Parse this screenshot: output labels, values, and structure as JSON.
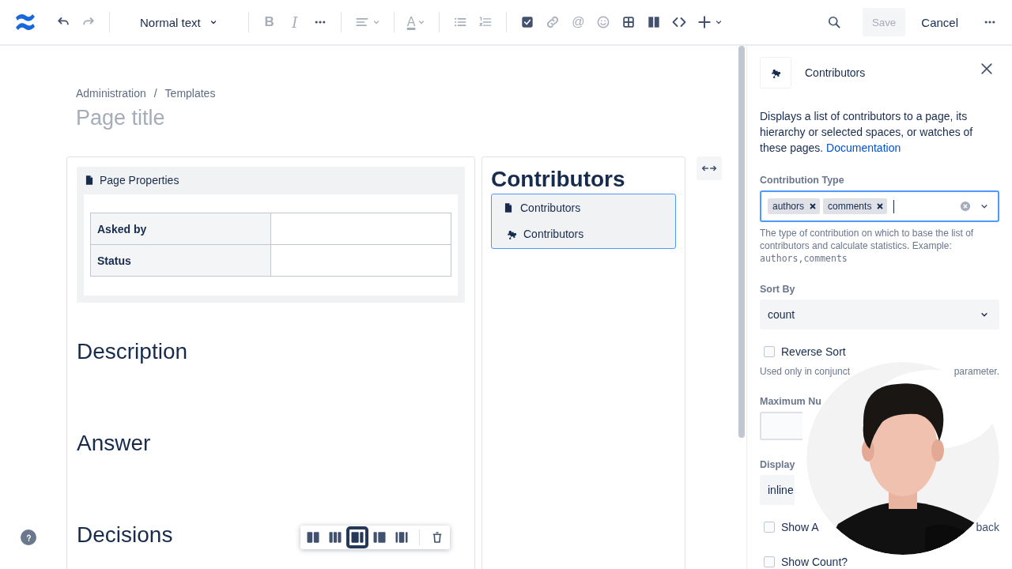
{
  "toolbar": {
    "left": [
      {
        "kind": "undo",
        "disabled": false
      },
      {
        "kind": "redo",
        "disabled": true
      },
      {
        "kind": "divider"
      },
      {
        "kind": "style-menu",
        "label": "Normal text"
      },
      {
        "kind": "divider"
      },
      {
        "kind": "bold",
        "label": "B",
        "disabled": true
      },
      {
        "kind": "italic",
        "label": "I",
        "disabled": true
      },
      {
        "kind": "more",
        "disabled": false
      },
      {
        "kind": "divider"
      },
      {
        "kind": "align",
        "disabled": true
      },
      {
        "kind": "divider"
      },
      {
        "kind": "text-color",
        "label": "A",
        "disabled": true
      },
      {
        "kind": "divider"
      },
      {
        "kind": "bullet-list",
        "disabled": true
      },
      {
        "kind": "numbered-list",
        "disabled": true
      },
      {
        "kind": "divider"
      },
      {
        "kind": "task",
        "disabled": false
      },
      {
        "kind": "link",
        "disabled": true
      },
      {
        "kind": "mention",
        "label": "@",
        "disabled": true
      },
      {
        "kind": "emoji",
        "disabled": true
      },
      {
        "kind": "table",
        "disabled": false
      },
      {
        "kind": "layout",
        "disabled": false
      },
      {
        "kind": "code",
        "disabled": false
      },
      {
        "kind": "insert",
        "disabled": false
      }
    ],
    "save": {
      "label": "Save",
      "disabled": true
    },
    "cancel": {
      "label": "Cancel"
    }
  },
  "breadcrumbs": [
    {
      "label": "Administration"
    },
    {
      "label": "Templates"
    }
  ],
  "breadcrumb_separator": "/",
  "title_placeholder": "Page title",
  "left_column": {
    "page_properties": {
      "title": "Page Properties",
      "rows": [
        {
          "label": "Asked by"
        },
        {
          "label": "Status"
        }
      ]
    },
    "headings": [
      "Description",
      "Answer",
      "Decisions"
    ]
  },
  "right_column": {
    "heading": "Contributors",
    "macro": {
      "title": "Contributors",
      "name": "Contributors",
      "selected": true
    }
  },
  "layout_toolbar": {
    "options": [
      {
        "kind": "two-equal",
        "selected": false
      },
      {
        "kind": "three-equal",
        "selected": false
      },
      {
        "kind": "right-sidebar",
        "selected": true
      },
      {
        "kind": "left-sidebar",
        "selected": false
      },
      {
        "kind": "three-sidebars",
        "selected": false
      }
    ]
  },
  "panel": {
    "title": "Contributors",
    "description": "Displays a list of contributors to a page, its hierarchy or selected spaces, or watches of these pages.",
    "link": "Documentation",
    "fields": [
      {
        "kind": "multi-select",
        "label": "Contribution Type",
        "tags": [
          "authors",
          "comments"
        ],
        "focused": true,
        "hint": "The type of contribution on which to base the list of contributors and calculate statistics. Example:",
        "example": "authors,comments"
      },
      {
        "kind": "select",
        "label": "Sort By",
        "value": "count"
      },
      {
        "kind": "checkbox",
        "label": "Reverse Sort",
        "checked": false,
        "hint": "Used only in conjunct",
        "hint_end": "parameter."
      },
      {
        "kind": "cut-input",
        "label": "Maximum Nu"
      },
      {
        "kind": "cut-select",
        "label": "Display",
        "value": "inline"
      },
      {
        "kind": "checkbox",
        "label": "Show A",
        "checked": false,
        "aside": "back"
      },
      {
        "kind": "checkbox",
        "label": "Show Count?",
        "checked": false
      }
    ]
  }
}
